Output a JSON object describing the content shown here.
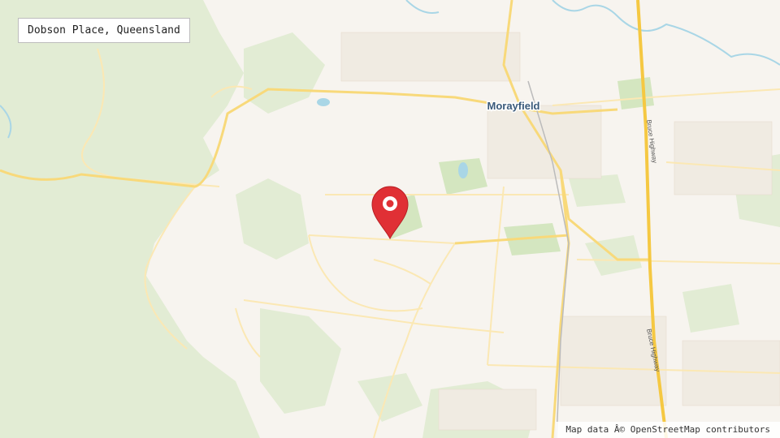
{
  "title": "Dobson Place, Queensland",
  "attribution": "Map data Â© OpenStreetMap contributors",
  "place_label": "Morayfield",
  "highway_labels": [
    "Bruce Highway",
    "Bruce Highway"
  ],
  "marker_icon": "map-pin-icon",
  "colors": {
    "land": "#f7f4ef",
    "forest": "#e2ecd4",
    "park": "#d8e8c8",
    "minor_road": "#fbe8b4",
    "major_road": "#f8d97a",
    "highway": "#f5c842",
    "water": "#a9d6e6",
    "place_label": "#3a5a7a",
    "marker": "#e03035"
  }
}
